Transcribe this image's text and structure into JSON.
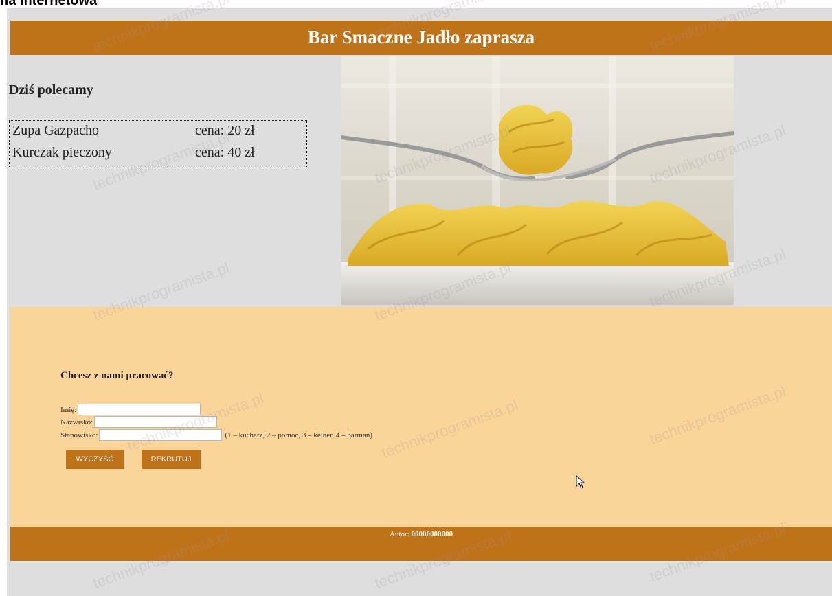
{
  "page_label": "na internetowa",
  "header": {
    "title": "Bar Smaczne Jadło zaprasza"
  },
  "recommend": {
    "title": "Dziś polecamy",
    "items": [
      {
        "name": "Zupa Gazpacho",
        "price": "cena: 20 zł"
      },
      {
        "name": "Kurczak pieczony",
        "price": "cena: 40 zł"
      }
    ]
  },
  "form": {
    "title": "Chcesz z nami pracować?",
    "first_name_label": "Imię:",
    "first_name_value": "",
    "last_name_label": "Nazwisko:",
    "last_name_value": "",
    "position_label": "Stanowisko:",
    "position_value": "",
    "position_hint": "(1 – kucharz, 2 – pomoc, 3 – kelner, 4 – barman)",
    "clear_label": "WYCZYŚĆ",
    "recruit_label": "REKRUTUJ"
  },
  "footer": {
    "author_label": "Autor:",
    "author_id": "00000000000"
  },
  "watermark": "technikprogramista.pl",
  "colors": {
    "accent": "#c07219",
    "page_bg": "#dedede",
    "form_bg": "#fbd49a"
  },
  "icons": {
    "photo": "pasta-photo",
    "cursor": "mouse-pointer-icon"
  }
}
